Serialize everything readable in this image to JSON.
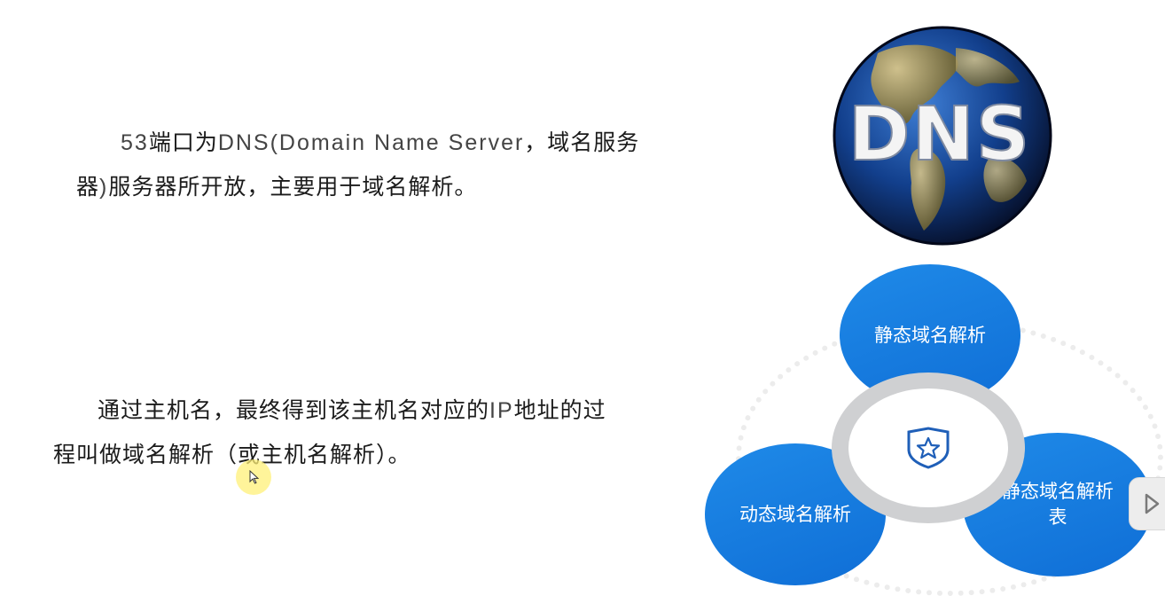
{
  "paragraph1": {
    "number": "53",
    "text_a": "端口为",
    "latin": "DNS(Domain Name Server",
    "text_b": "，域名服务",
    "line2_a": "器",
    "line2_paren": ")",
    "line2_b": "服务器所开放，主要用于域名解析。"
  },
  "paragraph2": {
    "text_a": "通过主机名，最终得到该主机名对应的",
    "latin": "IP",
    "text_b": "地址的过",
    "line2": "程叫做域名解析（或主机名解析）。"
  },
  "globe": {
    "label": "DNS",
    "colors": {
      "ocean": "#123f8c",
      "land": "#9c8a4a",
      "text": "#f4f4f4"
    }
  },
  "diagram": {
    "top_label": "静态域名解析",
    "left_label": "动态域名解析",
    "right_label": "静态域名解析表",
    "center_icon": "shield-star-icon",
    "colors": {
      "bubble": "#1a7fe3",
      "hub_ring": "#cfd0d2",
      "icon": "#1f5fb8"
    }
  },
  "navigation": {
    "next_icon": "play-right-icon"
  }
}
